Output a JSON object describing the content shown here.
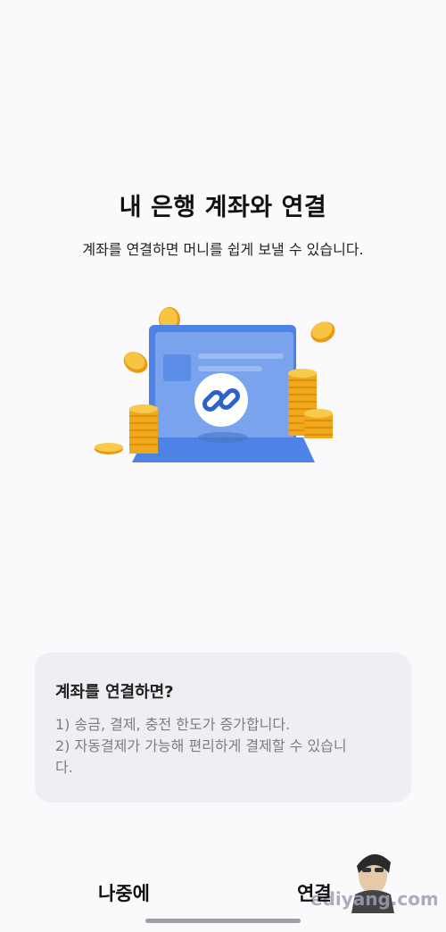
{
  "page": {
    "title": "내 은행 계좌와 연결",
    "subtitle": "계좌를 연결하면 머니를 쉽게 보낼 수 있습니다."
  },
  "info_card": {
    "title": "계좌를 연결하면?",
    "lines": [
      "1) 송금, 결제, 충전 한도가 증가합니다.",
      "2) 자동결제가 가능해 편리하게 결제할 수 있습니다."
    ]
  },
  "buttons": {
    "later_label": "나중에",
    "connect_label": "연결"
  },
  "watermark": {
    "text": "ediyang.com"
  },
  "colors": {
    "accent_blue": "#4e82e6",
    "coin_gold": "#f5b323",
    "card_bg": "#efeff3",
    "page_bg": "#fafafc"
  },
  "icons": {
    "illustration": "bank-account-link-illustration",
    "link": "chain-link-icon"
  }
}
